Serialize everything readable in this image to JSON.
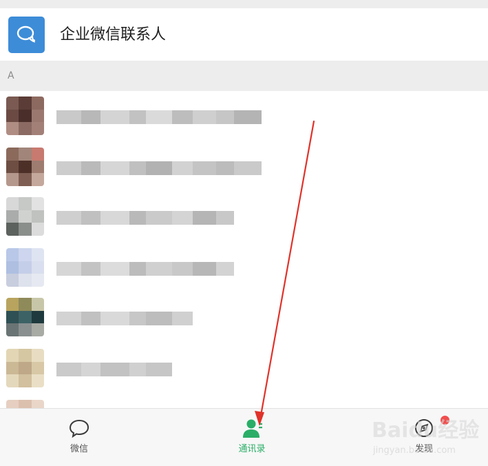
{
  "wecom_entry": {
    "label": "企业微信联系人",
    "icon": "wecom-chat-icon",
    "color": "#3d8cd8"
  },
  "index_section": {
    "letter": "A"
  },
  "contacts": [
    {
      "avatar_palette": [
        "#7a5a52",
        "#5b3c36",
        "#8d6a60",
        "#6c4a44",
        "#4a2e2a",
        "#9a7870",
        "#b08d83",
        "#8a6a62",
        "#a28078"
      ],
      "name_blocks": [
        "#c9c9c9",
        "#b8b8b8",
        "#d4d4d4",
        "#c2c2c2",
        "#dadada",
        "#bdbdbd",
        "#cfcfcf",
        "#c6c6c6",
        "#b4b4b4"
      ]
    },
    {
      "avatar_palette": [
        "#8b6a5c",
        "#a2857a",
        "#c87a70",
        "#6e4e42",
        "#4c3028",
        "#9e7c70",
        "#b5988c",
        "#7e5e52",
        "#c5a89c"
      ],
      "name_blocks": [
        "#cdcdcd",
        "#bababa",
        "#d6d6d6",
        "#c0c0c0",
        "#b2b2b2",
        "#d2d2d2",
        "#c4c4c4",
        "#bcbcbc",
        "#cacaca"
      ]
    },
    {
      "avatar_palette": [
        "#d8d8d8",
        "#c6c9c6",
        "#e2e2e2",
        "#a9acaa",
        "#cfd2cf",
        "#bfc2bf",
        "#5c625e",
        "#8b8f8c",
        "#dcdcdc"
      ],
      "name_blocks": [
        "#cfcfcf",
        "#c0c0c0",
        "#d8d8d8",
        "#b9b9b9",
        "#cacaca",
        "#d4d4d4",
        "#b5b5b5",
        "#c8c8c8"
      ]
    },
    {
      "avatar_palette": [
        "#b9c8e8",
        "#cdd6ee",
        "#dfe4f2",
        "#aebfe2",
        "#c5cee8",
        "#d9dfee",
        "#c8cede",
        "#dde2ec",
        "#e6e9f1"
      ],
      "name_blocks": [
        "#d6d6d6",
        "#c3c3c3",
        "#dcdcdc",
        "#bcbcbc",
        "#d0d0d0",
        "#c8c8c8",
        "#b7b7b7",
        "#d3d3d3"
      ]
    },
    {
      "avatar_palette": [
        "#b8a45e",
        "#8f8a5a",
        "#c8c6a8",
        "#2f5054",
        "#3d6266",
        "#1f3a3e",
        "#6a7474",
        "#8a9090",
        "#a8aaa4"
      ],
      "name_blocks": [
        "#d3d3d3",
        "#c1c1c1",
        "#d9d9d9",
        "#c7c7c7",
        "#bdbdbd",
        "#d0d0d0"
      ]
    },
    {
      "avatar_palette": [
        "#e2d6b4",
        "#d5c7a2",
        "#e8ddc2",
        "#cbb894",
        "#bfa888",
        "#d8c8a6",
        "#e4d8bc",
        "#d2c09e",
        "#eadfc6"
      ],
      "name_blocks": [
        "#cacaca",
        "#d5d5d5",
        "#c2c2c2",
        "#d0d0d0",
        "#c6c6c6"
      ]
    },
    {
      "avatar_palette": [
        "#e6cfc0",
        "#dcc0ae",
        "#ead6c9",
        "#d8bda9",
        "#cfb29d",
        "#e2c9b8"
      ],
      "name_blocks": []
    }
  ],
  "tab_bar": {
    "tabs": [
      {
        "label": "微信",
        "icon": "chat-bubble-icon",
        "active": false
      },
      {
        "label": "通讯录",
        "icon": "contacts-person-icon",
        "active": true
      },
      {
        "label": "发现",
        "icon": "discover-compass-icon",
        "active": false,
        "badge": "red-dot"
      }
    ],
    "active_color": "#2aae67",
    "inactive_color": "#555555"
  },
  "annotation": {
    "type": "red-arrow",
    "color": "#e0322a",
    "points_to": "通讯录"
  },
  "watermark": {
    "main": "Baidu经验",
    "sub": "jingyan.baidu.com"
  }
}
